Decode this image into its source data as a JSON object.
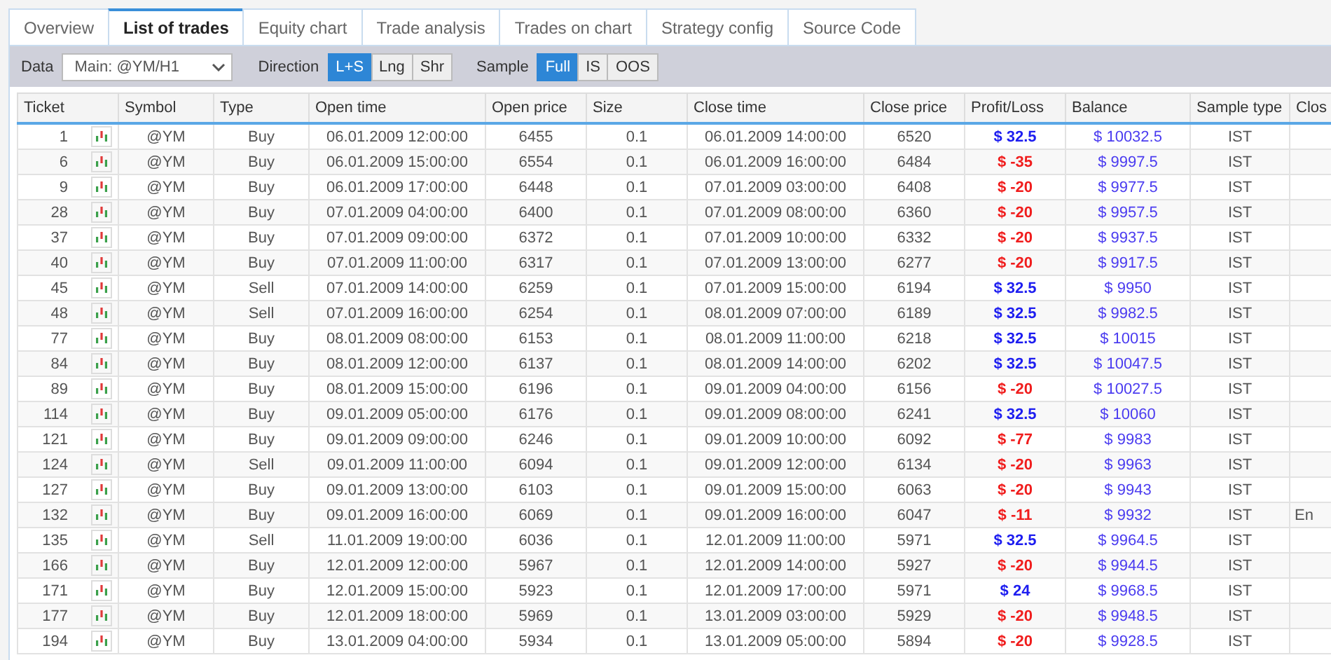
{
  "tabs": [
    {
      "label": "Overview",
      "selected": false
    },
    {
      "label": "List of trades",
      "selected": true
    },
    {
      "label": "Equity chart",
      "selected": false
    },
    {
      "label": "Trade analysis",
      "selected": false
    },
    {
      "label": "Trades on chart",
      "selected": false
    },
    {
      "label": "Strategy config",
      "selected": false
    },
    {
      "label": "Source Code",
      "selected": false
    }
  ],
  "toolbar": {
    "data_label": "Data",
    "data_value": "Main: @YM/H1",
    "direction_label": "Direction",
    "direction_options": [
      {
        "label": "L+S",
        "selected": true
      },
      {
        "label": "Lng",
        "selected": false
      },
      {
        "label": "Shr",
        "selected": false
      }
    ],
    "sample_label": "Sample",
    "sample_options": [
      {
        "label": "Full",
        "selected": true
      },
      {
        "label": "IS",
        "selected": false
      },
      {
        "label": "OOS",
        "selected": false
      }
    ]
  },
  "table": {
    "columns": [
      "Ticket",
      "Symbol",
      "Type",
      "Open time",
      "Open price",
      "Size",
      "Close time",
      "Close price",
      "Profit/Loss",
      "Balance",
      "Sample type",
      "Clos"
    ],
    "rows": [
      {
        "ticket": "1",
        "symbol": "@YM",
        "type": "Buy",
        "open_time": "06.01.2009 12:00:00",
        "open_price": "6455",
        "size": "0.1",
        "close_time": "06.01.2009 14:00:00",
        "close_price": "6520",
        "profit_loss": "$ 32.5",
        "color": "#1d1df0",
        "balance": "$ 10032.5",
        "sample_type": "IST"
      },
      {
        "ticket": "6",
        "symbol": "@YM",
        "type": "Buy",
        "open_time": "06.01.2009 15:00:00",
        "open_price": "6554",
        "size": "0.1",
        "close_time": "06.01.2009 16:00:00",
        "close_price": "6484",
        "profit_loss": "$ -35",
        "color": "#f01d1d",
        "balance": "$ 9997.5",
        "sample_type": "IST"
      },
      {
        "ticket": "9",
        "symbol": "@YM",
        "type": "Buy",
        "open_time": "06.01.2009 17:00:00",
        "open_price": "6448",
        "size": "0.1",
        "close_time": "07.01.2009 03:00:00",
        "close_price": "6408",
        "profit_loss": "$ -20",
        "color": "#f01d1d",
        "balance": "$ 9977.5",
        "sample_type": "IST"
      },
      {
        "ticket": "28",
        "symbol": "@YM",
        "type": "Buy",
        "open_time": "07.01.2009 04:00:00",
        "open_price": "6400",
        "size": "0.1",
        "close_time": "07.01.2009 08:00:00",
        "close_price": "6360",
        "profit_loss": "$ -20",
        "color": "#f01d1d",
        "balance": "$ 9957.5",
        "sample_type": "IST"
      },
      {
        "ticket": "37",
        "symbol": "@YM",
        "type": "Buy",
        "open_time": "07.01.2009 09:00:00",
        "open_price": "6372",
        "size": "0.1",
        "close_time": "07.01.2009 10:00:00",
        "close_price": "6332",
        "profit_loss": "$ -20",
        "color": "#f01d1d",
        "balance": "$ 9937.5",
        "sample_type": "IST"
      },
      {
        "ticket": "40",
        "symbol": "@YM",
        "type": "Buy",
        "open_time": "07.01.2009 11:00:00",
        "open_price": "6317",
        "size": "0.1",
        "close_time": "07.01.2009 13:00:00",
        "close_price": "6277",
        "profit_loss": "$ -20",
        "color": "#f01d1d",
        "balance": "$ 9917.5",
        "sample_type": "IST"
      },
      {
        "ticket": "45",
        "symbol": "@YM",
        "type": "Sell",
        "open_time": "07.01.2009 14:00:00",
        "open_price": "6259",
        "size": "0.1",
        "close_time": "07.01.2009 15:00:00",
        "close_price": "6194",
        "profit_loss": "$ 32.5",
        "color": "#1d1df0",
        "balance": "$ 9950",
        "sample_type": "IST"
      },
      {
        "ticket": "48",
        "symbol": "@YM",
        "type": "Sell",
        "open_time": "07.01.2009 16:00:00",
        "open_price": "6254",
        "size": "0.1",
        "close_time": "08.01.2009 07:00:00",
        "close_price": "6189",
        "profit_loss": "$ 32.5",
        "color": "#1d1df0",
        "balance": "$ 9982.5",
        "sample_type": "IST"
      },
      {
        "ticket": "77",
        "symbol": "@YM",
        "type": "Buy",
        "open_time": "08.01.2009 08:00:00",
        "open_price": "6153",
        "size": "0.1",
        "close_time": "08.01.2009 11:00:00",
        "close_price": "6218",
        "profit_loss": "$ 32.5",
        "color": "#1d1df0",
        "balance": "$ 10015",
        "sample_type": "IST"
      },
      {
        "ticket": "84",
        "symbol": "@YM",
        "type": "Buy",
        "open_time": "08.01.2009 12:00:00",
        "open_price": "6137",
        "size": "0.1",
        "close_time": "08.01.2009 14:00:00",
        "close_price": "6202",
        "profit_loss": "$ 32.5",
        "color": "#1d1df0",
        "balance": "$ 10047.5",
        "sample_type": "IST"
      },
      {
        "ticket": "89",
        "symbol": "@YM",
        "type": "Buy",
        "open_time": "08.01.2009 15:00:00",
        "open_price": "6196",
        "size": "0.1",
        "close_time": "09.01.2009 04:00:00",
        "close_price": "6156",
        "profit_loss": "$ -20",
        "color": "#f01d1d",
        "balance": "$ 10027.5",
        "sample_type": "IST"
      },
      {
        "ticket": "114",
        "symbol": "@YM",
        "type": "Buy",
        "open_time": "09.01.2009 05:00:00",
        "open_price": "6176",
        "size": "0.1",
        "close_time": "09.01.2009 08:00:00",
        "close_price": "6241",
        "profit_loss": "$ 32.5",
        "color": "#1d1df0",
        "balance": "$ 10060",
        "sample_type": "IST"
      },
      {
        "ticket": "121",
        "symbol": "@YM",
        "type": "Buy",
        "open_time": "09.01.2009 09:00:00",
        "open_price": "6246",
        "size": "0.1",
        "close_time": "09.01.2009 10:00:00",
        "close_price": "6092",
        "profit_loss": "$ -77",
        "color": "#f01d1d",
        "balance": "$ 9983",
        "sample_type": "IST"
      },
      {
        "ticket": "124",
        "symbol": "@YM",
        "type": "Sell",
        "open_time": "09.01.2009 11:00:00",
        "open_price": "6094",
        "size": "0.1",
        "close_time": "09.01.2009 12:00:00",
        "close_price": "6134",
        "profit_loss": "$ -20",
        "color": "#f01d1d",
        "balance": "$ 9963",
        "sample_type": "IST"
      },
      {
        "ticket": "127",
        "symbol": "@YM",
        "type": "Buy",
        "open_time": "09.01.2009 13:00:00",
        "open_price": "6103",
        "size": "0.1",
        "close_time": "09.01.2009 15:00:00",
        "close_price": "6063",
        "profit_loss": "$ -20",
        "color": "#f01d1d",
        "balance": "$ 9943",
        "sample_type": "IST"
      },
      {
        "ticket": "132",
        "symbol": "@YM",
        "type": "Buy",
        "open_time": "09.01.2009 16:00:00",
        "open_price": "6069",
        "size": "0.1",
        "close_time": "09.01.2009 16:00:00",
        "close_price": "6047",
        "profit_loss": "$ -11",
        "color": "#f01d1d",
        "balance": "$ 9932",
        "sample_type": "IST",
        "column_12": "En"
      },
      {
        "ticket": "135",
        "symbol": "@YM",
        "type": "Sell",
        "open_time": "11.01.2009 19:00:00",
        "open_price": "6036",
        "size": "0.1",
        "close_time": "12.01.2009 11:00:00",
        "close_price": "5971",
        "profit_loss": "$ 32.5",
        "color": "#1d1df0",
        "balance": "$ 9964.5",
        "sample_type": "IST"
      },
      {
        "ticket": "166",
        "symbol": "@YM",
        "type": "Buy",
        "open_time": "12.01.2009 12:00:00",
        "open_price": "5967",
        "size": "0.1",
        "close_time": "12.01.2009 14:00:00",
        "close_price": "5927",
        "profit_loss": "$ -20",
        "color": "#f01d1d",
        "balance": "$ 9944.5",
        "sample_type": "IST"
      },
      {
        "ticket": "171",
        "symbol": "@YM",
        "type": "Buy",
        "open_time": "12.01.2009 15:00:00",
        "open_price": "5923",
        "size": "0.1",
        "close_time": "12.01.2009 17:00:00",
        "close_price": "5971",
        "profit_loss": "$ 24",
        "color": "#1d1df0",
        "balance": "$ 9968.5",
        "sample_type": "IST"
      },
      {
        "ticket": "177",
        "symbol": "@YM",
        "type": "Buy",
        "open_time": "12.01.2009 18:00:00",
        "open_price": "5969",
        "size": "0.1",
        "close_time": "13.01.2009 03:00:00",
        "close_price": "5929",
        "profit_loss": "$ -20",
        "color": "#f01d1d",
        "balance": "$ 9948.5",
        "sample_type": "IST"
      },
      {
        "ticket": "194",
        "symbol": "@YM",
        "type": "Buy",
        "open_time": "13.01.2009 04:00:00",
        "open_price": "5934",
        "size": "0.1",
        "close_time": "13.01.2009 05:00:00",
        "close_price": "5894",
        "profit_loss": "$ -20",
        "color": "#f01d1d",
        "balance": "$ 9928.5",
        "sample_type": "IST"
      }
    ]
  }
}
